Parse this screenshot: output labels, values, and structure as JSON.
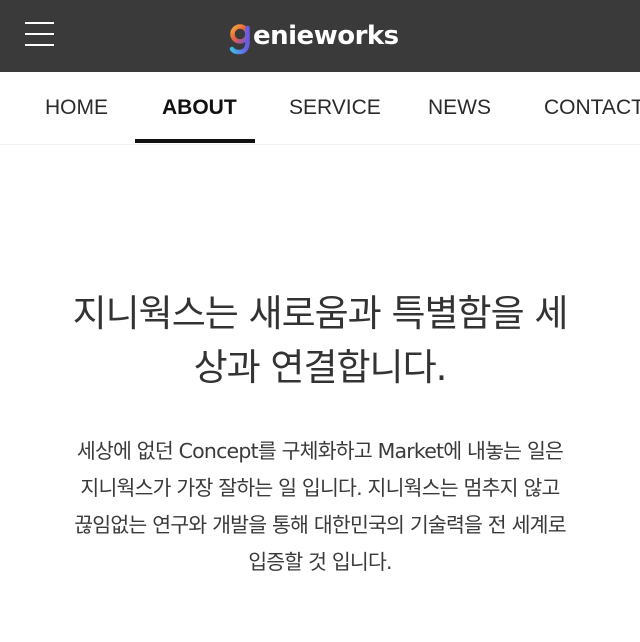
{
  "header": {
    "menu_icon": "hamburger-menu-icon",
    "logo_text": "enieworks",
    "logo_letter": "g",
    "background_color": "#3a3a3a"
  },
  "nav": {
    "items": [
      {
        "label": "HOME",
        "active": false
      },
      {
        "label": "ABOUT",
        "active": true
      },
      {
        "label": "SERVICE",
        "active": false
      },
      {
        "label": "NEWS",
        "active": false
      },
      {
        "label": "CONTACT",
        "active": false
      }
    ]
  },
  "main": {
    "headline_line1": "지니웍스는 새로움과 특별함을 세",
    "headline_line2": "상과 연결합니다.",
    "body_line1": "세상에 없던 Concept를 구체화하고 Market에 내놓는 일은",
    "body_line2": "지니웍스가 가장 잘하는 일 입니다. 지니웍스는 멈추지 않고",
    "body_line3": "끊임없는 연구와 개발을 통해 대한민국의 기술력을 전 세계로",
    "body_line4": "입증할 것 입니다."
  }
}
